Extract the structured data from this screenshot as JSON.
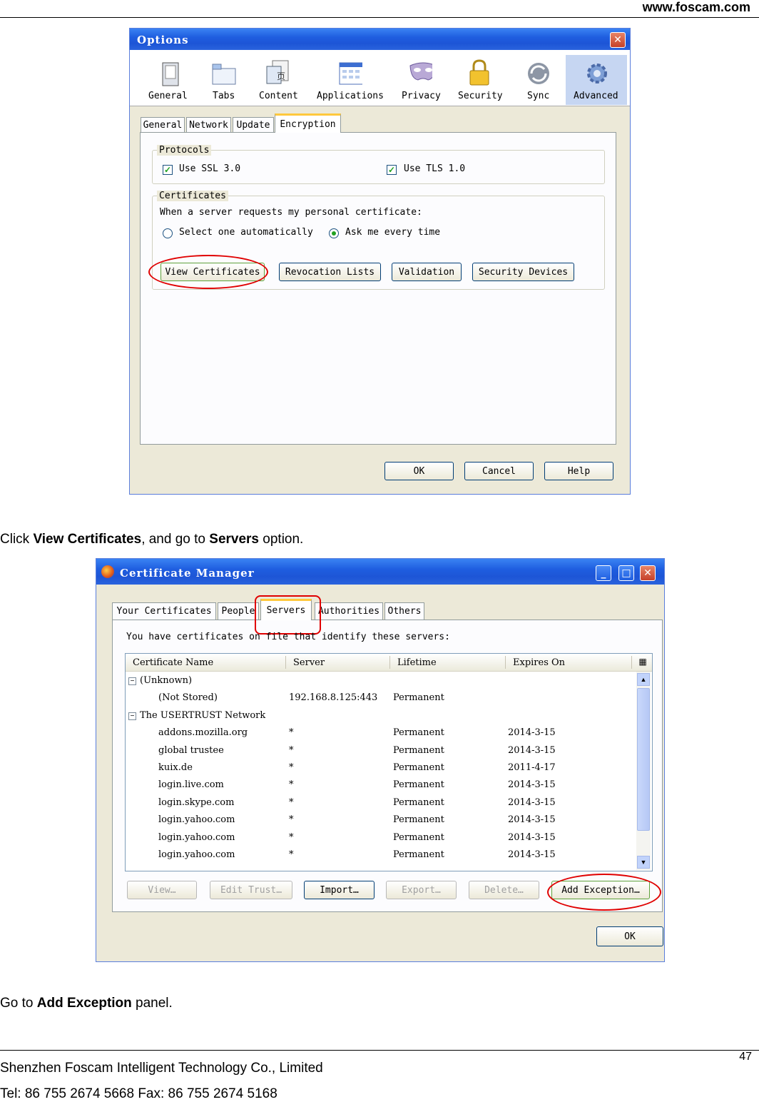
{
  "header": {
    "url": "www.foscam.com"
  },
  "options_window": {
    "title": "Options",
    "toolbar": [
      "General",
      "Tabs",
      "Content",
      "Applications",
      "Privacy",
      "Security",
      "Sync",
      "Advanced"
    ],
    "tabs": [
      "General",
      "Network",
      "Update",
      "Encryption"
    ],
    "protocols_label": "Protocols",
    "ssl_label": "Use SSL 3.0",
    "tls_label": "Use TLS 1.0",
    "certificates_label": "Certificates",
    "cert_prompt": "When a server requests my personal certificate:",
    "radio_auto": "Select one automatically",
    "radio_ask": "Ask me every time",
    "buttons": [
      "View Certificates",
      "Revocation Lists",
      "Validation",
      "Security Devices"
    ],
    "ok": "OK",
    "cancel": "Cancel",
    "help": "Help"
  },
  "caption1": {
    "pre": "Click ",
    "b1": "View Certificates",
    "mid": ", and go to ",
    "b2": "Servers",
    "post": " option."
  },
  "cert_window": {
    "title": "Certificate Manager",
    "tabs": [
      "Your Certificates",
      "People",
      "Servers",
      "Authorities",
      "Others"
    ],
    "intro": "You have certificates on file that identify these servers:",
    "columns": [
      "Certificate Name",
      "Server",
      "Lifetime",
      "Expires On"
    ],
    "rows": [
      {
        "name": "(Unknown)",
        "server": "",
        "lifetime": "",
        "expires": "",
        "group": true
      },
      {
        "name": "(Not Stored)",
        "server": "192.168.8.125:443",
        "lifetime": "Permanent",
        "expires": ""
      },
      {
        "name": "The USERTRUST Network",
        "server": "",
        "lifetime": "",
        "expires": "",
        "group": true
      },
      {
        "name": "addons.mozilla.org",
        "server": "*",
        "lifetime": "Permanent",
        "expires": "2014-3-15"
      },
      {
        "name": "global trustee",
        "server": "*",
        "lifetime": "Permanent",
        "expires": "2014-3-15"
      },
      {
        "name": "kuix.de",
        "server": "*",
        "lifetime": "Permanent",
        "expires": "2011-4-17"
      },
      {
        "name": "login.live.com",
        "server": "*",
        "lifetime": "Permanent",
        "expires": "2014-3-15"
      },
      {
        "name": "login.skype.com",
        "server": "*",
        "lifetime": "Permanent",
        "expires": "2014-3-15"
      },
      {
        "name": "login.yahoo.com",
        "server": "*",
        "lifetime": "Permanent",
        "expires": "2014-3-15"
      },
      {
        "name": "login.yahoo.com",
        "server": "*",
        "lifetime": "Permanent",
        "expires": "2014-3-15"
      },
      {
        "name": "login.yahoo.com",
        "server": "*",
        "lifetime": "Permanent",
        "expires": "2014-3-15"
      }
    ],
    "buttons": [
      "View…",
      "Edit Trust…",
      "Import…",
      "Export…",
      "Delete…",
      "Add Exception…"
    ],
    "ok": "OK"
  },
  "caption2": {
    "pre": "Go to ",
    "b1": "Add Exception",
    "post": " panel."
  },
  "footer": {
    "company": "Shenzhen Foscam Intelligent Technology Co., Limited",
    "tel": "Tel: 86 755 2674 5668 Fax: 86 755 2674 5168",
    "page": "47"
  }
}
